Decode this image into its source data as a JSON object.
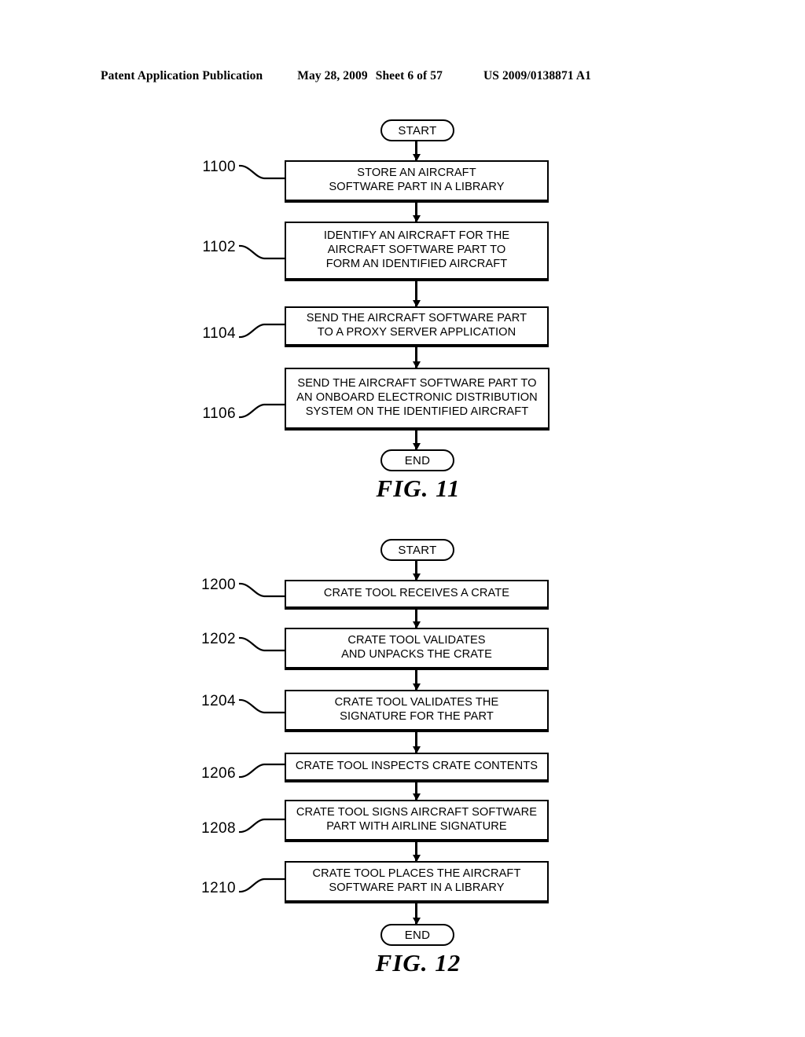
{
  "header": {
    "publication": "Patent Application Publication",
    "date": "May 28, 2009",
    "sheet": "Sheet 6 of 57",
    "patent_number": "US 2009/0138871 A1"
  },
  "figures": [
    {
      "caption": "FIG. 11",
      "start_label": "START",
      "end_label": "END",
      "steps": [
        {
          "ref": "1100",
          "text": "STORE AN AIRCRAFT\nSOFTWARE PART IN A LIBRARY"
        },
        {
          "ref": "1102",
          "text": "IDENTIFY AN AIRCRAFT FOR THE\nAIRCRAFT SOFTWARE PART TO\nFORM AN IDENTIFIED AIRCRAFT"
        },
        {
          "ref": "1104",
          "text": "SEND THE AIRCRAFT SOFTWARE PART\nTO A PROXY SERVER APPLICATION"
        },
        {
          "ref": "1106",
          "text": "SEND THE AIRCRAFT SOFTWARE PART TO\nAN ONBOARD ELECTRONIC DISTRIBUTION\nSYSTEM ON THE IDENTIFIED AIRCRAFT"
        }
      ]
    },
    {
      "caption": "FIG. 12",
      "start_label": "START",
      "end_label": "END",
      "steps": [
        {
          "ref": "1200",
          "text": "CRATE TOOL RECEIVES A CRATE"
        },
        {
          "ref": "1202",
          "text": "CRATE TOOL VALIDATES\nAND UNPACKS THE CRATE"
        },
        {
          "ref": "1204",
          "text": "CRATE TOOL VALIDATES THE\nSIGNATURE FOR THE PART"
        },
        {
          "ref": "1206",
          "text": "CRATE TOOL INSPECTS CRATE CONTENTS"
        },
        {
          "ref": "1208",
          "text": "CRATE TOOL SIGNS AIRCRAFT SOFTWARE\nPART WITH AIRLINE SIGNATURE"
        },
        {
          "ref": "1210",
          "text": "CRATE TOOL PLACES THE AIRCRAFT\nSOFTWARE PART IN A LIBRARY"
        }
      ]
    }
  ]
}
